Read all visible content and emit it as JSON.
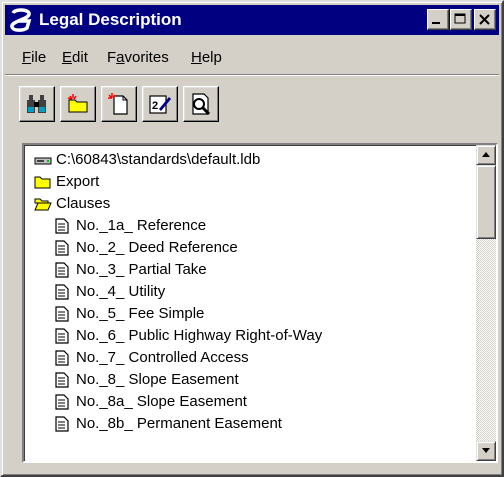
{
  "window": {
    "title": "Legal Description",
    "controls": {
      "minimize": "minimize",
      "maximize": "maximize",
      "close": "close"
    }
  },
  "menu": [
    {
      "label": "File",
      "accel": "F",
      "rest": "ile"
    },
    {
      "label": "Edit",
      "accel": "E",
      "rest": "dit"
    },
    {
      "label": "Favorites",
      "accel": "a",
      "pre": "F",
      "rest": "vorites"
    },
    {
      "label": "Help",
      "accel": "H",
      "rest": "elp"
    }
  ],
  "toolbar": {
    "buttons": [
      "find-icon",
      "open-folder-icon",
      "new-document-icon",
      "rename-icon",
      "preview-icon"
    ]
  },
  "tree": {
    "root": "C:\\60843\\standards\\default.ldb",
    "folders": [
      "Export",
      "Clauses"
    ],
    "items": [
      "No._1a_ Reference",
      "No._2_ Deed Reference",
      "No._3_ Partial Take",
      "No._4_ Utility",
      "No._5_ Fee Simple",
      "No._6_ Public Highway Right-of-Way",
      "No._7_ Controlled Access",
      "No._8_ Slope Easement",
      "No._8a_ Slope Easement",
      "No._8b_ Permanent Easement"
    ]
  },
  "scrollbar": {
    "position_fraction": 0.0,
    "visible_fraction": 0.25
  },
  "colors": {
    "titlebar": "#000080",
    "face": "#d4d0c8",
    "folder": "#ffff00"
  }
}
